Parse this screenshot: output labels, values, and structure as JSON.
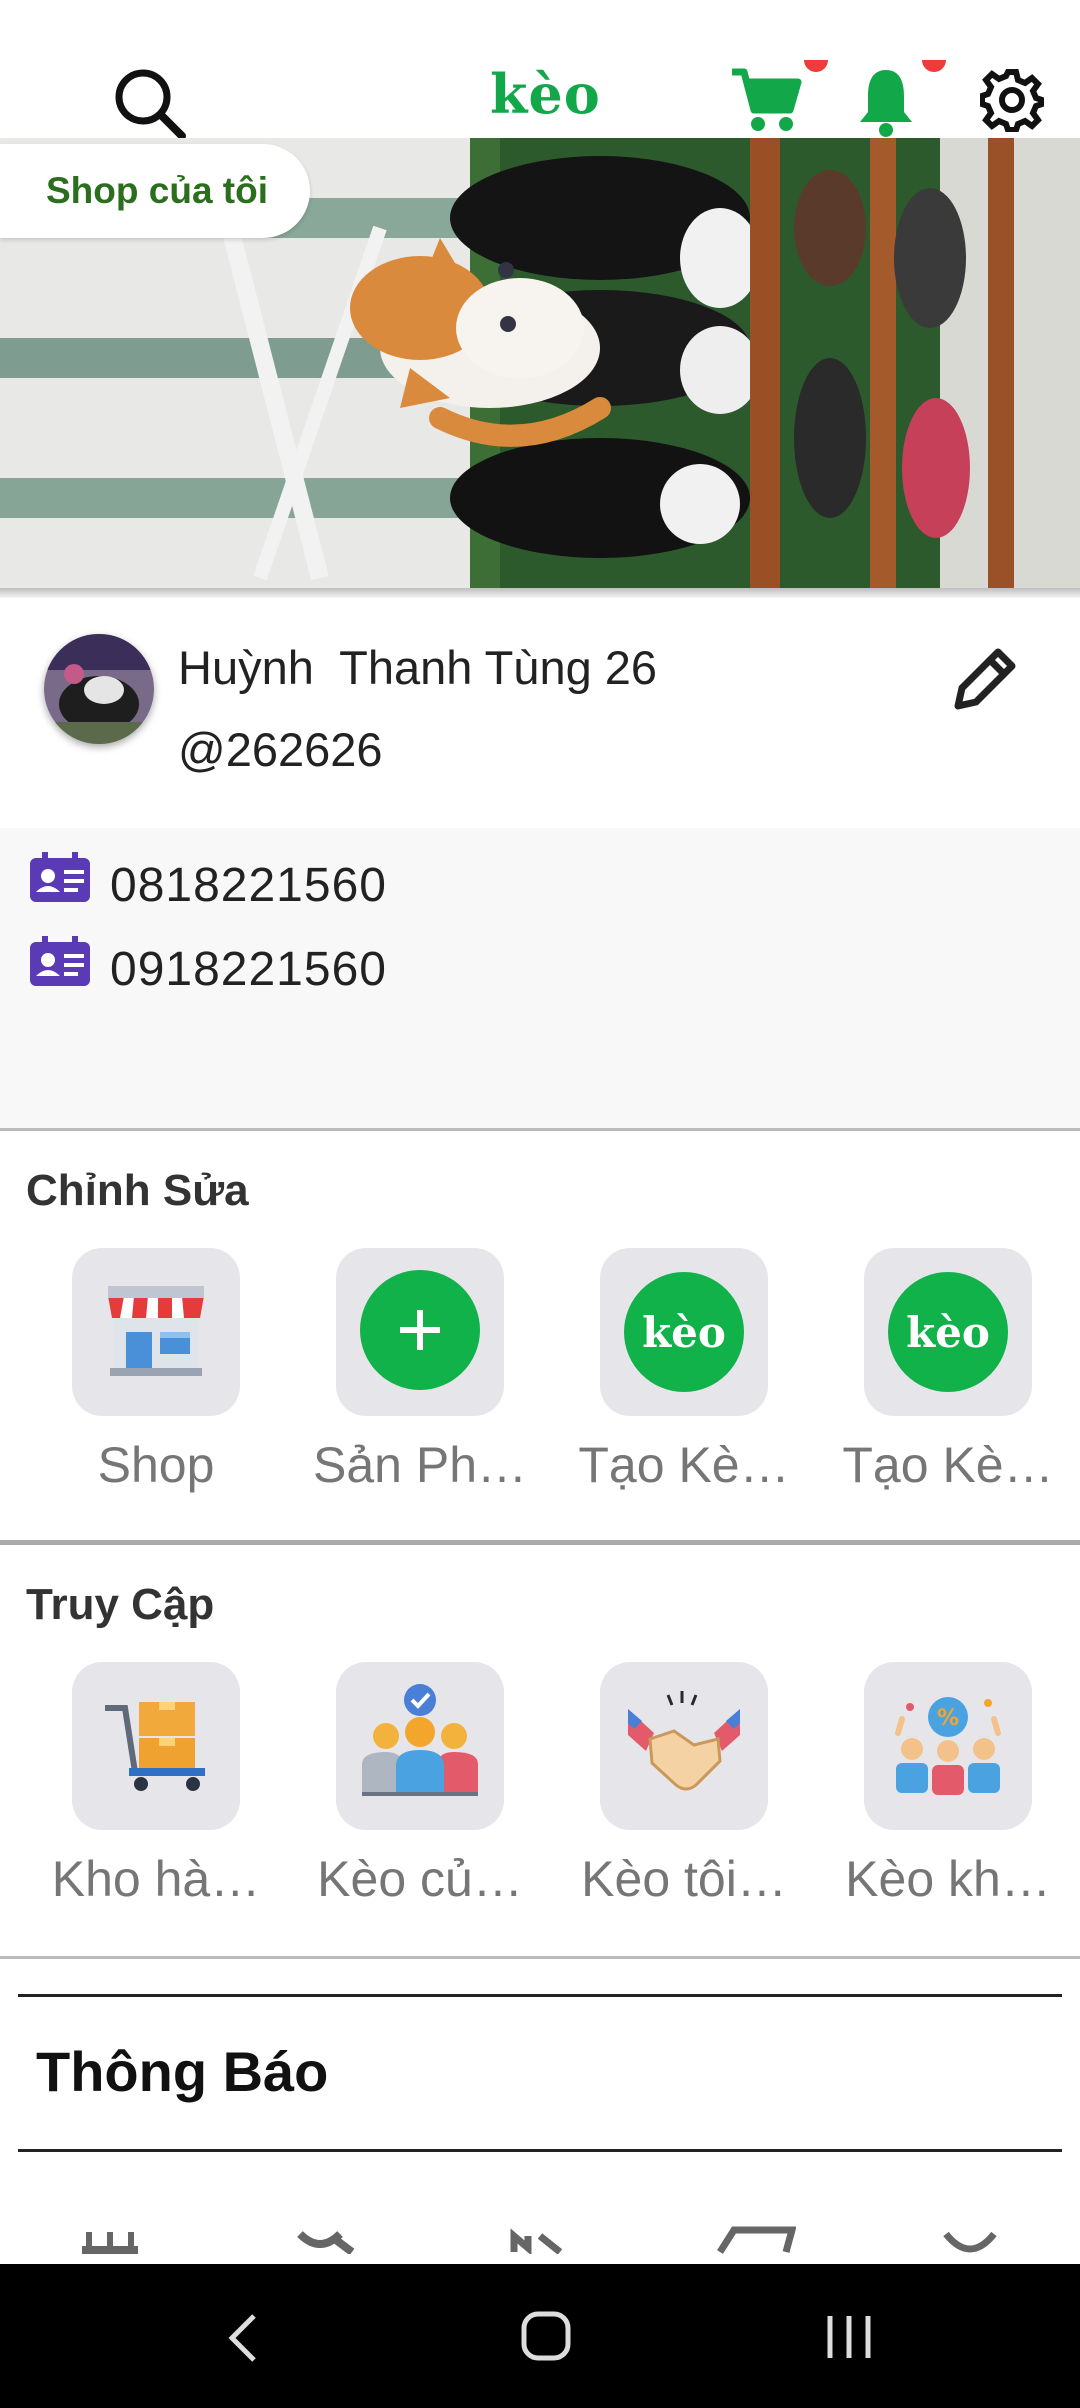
{
  "header": {
    "logo": "kèo",
    "icons": [
      "search-icon",
      "cart-icon",
      "bell-icon",
      "gear-icon"
    ],
    "accent": "#12a84a"
  },
  "cover": {
    "shop_label": "Shop của tôi"
  },
  "profile": {
    "name": "Huỳnh  Thanh Tùng 26",
    "handle": "@262626"
  },
  "phones": [
    "0818221560",
    "0918221560"
  ],
  "edit_section": {
    "title": "Chỉnh Sửa",
    "items": [
      {
        "label": "Shop",
        "icon": "storefront-icon"
      },
      {
        "label": "Sản Ph…",
        "icon": "add-icon"
      },
      {
        "label": "Tạo Kè…",
        "icon": "keo-logo-icon",
        "logo_text": "kèo"
      },
      {
        "label": "Tạo Kè…",
        "icon": "keo-logo-icon",
        "logo_text": "kèo"
      }
    ]
  },
  "access_section": {
    "title": "Truy Cập",
    "items": [
      {
        "label": "Kho hà…",
        "icon": "warehouse-cart-icon"
      },
      {
        "label": "Kèo củ…",
        "icon": "group-check-icon"
      },
      {
        "label": "Kèo tôi…",
        "icon": "handshake-icon"
      },
      {
        "label": "Kèo kh…",
        "icon": "celebration-icon"
      }
    ]
  },
  "notice": {
    "title": "Thông Báo"
  },
  "system_nav": [
    "back-icon",
    "home-icon",
    "recents-icon"
  ]
}
